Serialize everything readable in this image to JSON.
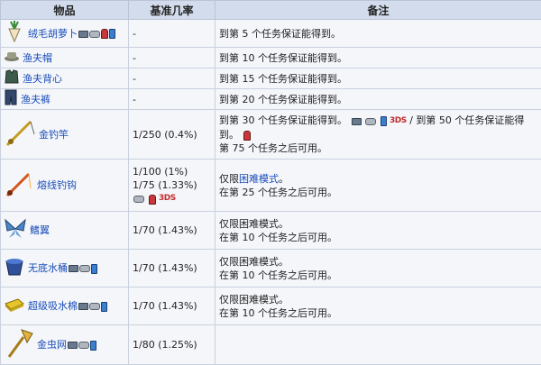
{
  "headers": {
    "item": "物品",
    "rate": "基准几率",
    "note": "备注"
  },
  "rows": [
    {
      "name": "绒毛胡萝卜",
      "icon": "fuzzy-carrot-icon",
      "rate": "-",
      "note_lines": [
        "到第 5 个任务保证能得到。"
      ]
    },
    {
      "name": "渔夫帽",
      "icon": "anglers-hat-icon",
      "rate": "-",
      "note_lines": [
        "到第 10 个任务保证能得到。"
      ]
    },
    {
      "name": "渔夫背心",
      "icon": "anglers-vest-icon",
      "rate": "-",
      "note_lines": [
        "到第 15 个任务保证能得到。"
      ]
    },
    {
      "name": "渔夫裤",
      "icon": "anglers-pants-icon",
      "rate": "-",
      "note_lines": [
        "到第 20 个任务保证能得到。"
      ]
    },
    {
      "name": "金钓竿",
      "icon": "golden-fishing-rod-icon",
      "rate": "1/250 (0.4%)",
      "note_a": "到第 30 个任务保证能得到。",
      "note_b": "/ 到第 50 个任务保证能得",
      "note_c": "到。",
      "note_d": "第 75 个任务之后可用。"
    },
    {
      "name": "熔线钓钩",
      "icon": "hotline-fishing-hook-icon",
      "rate_lines": [
        "1/100 (1%)",
        "1/75 (1.33%)"
      ],
      "note_pre": "仅限",
      "note_link": "困难模式",
      "note_post": "。",
      "note_line2": "在第 25 个任务之后可用。"
    },
    {
      "name": "鳍翼",
      "icon": "fin-wings-icon",
      "rate": "1/70 (1.43%)",
      "note_lines": [
        "仅限困难模式。",
        "在第 10 个任务之后可用。"
      ]
    },
    {
      "name": "无底水桶",
      "icon": "bottomless-bucket-icon",
      "rate": "1/70 (1.43%)",
      "note_lines": [
        "仅限困难模式。",
        "在第 10 个任务之后可用。"
      ]
    },
    {
      "name": "超级吸水棉",
      "icon": "super-absorbant-sponge-icon",
      "rate": "1/70 (1.43%)",
      "note_lines": [
        "仅限困难模式。",
        "在第 10 个任务之后可用。"
      ]
    },
    {
      "name": "金虫网",
      "icon": "golden-bug-net-icon",
      "rate": "1/80 (1.25%)",
      "note_lines": []
    }
  ],
  "platform_tag": "3DS",
  "colors": {
    "header_bg": "#d3dcec",
    "row_bg": "#f4f6fa",
    "link": "#1a4db8",
    "border": "#c9d1de"
  }
}
